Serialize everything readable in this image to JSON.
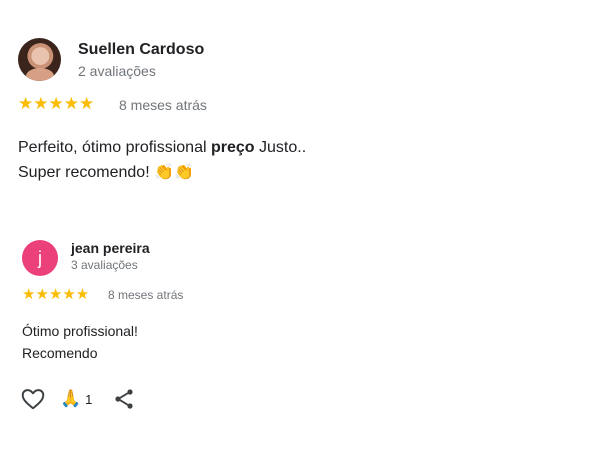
{
  "reviews": [
    {
      "author": "Suellen Cardoso",
      "review_count": "2 avaliações",
      "stars": "★★★★★",
      "rating": 5,
      "date": "8 meses atrás",
      "text_line1_a": "Perfeito, ótimo profissional ",
      "text_line1_bold": "preço",
      "text_line1_b": " Justo..",
      "text_line2": "Super recomendo! 👏👏"
    },
    {
      "author": "jean pereira",
      "avatar_letter": "j",
      "review_count": "3 avaliações",
      "stars": "★★★★★",
      "rating": 5,
      "date": "8 meses atrás",
      "text_line1": "Ótimo profissional!",
      "text_line2": "Recomendo"
    }
  ],
  "actions": {
    "like_icon": "heart-outline-icon",
    "reaction_emoji": "🙏",
    "reaction_count": "1",
    "share_icon": "share-icon"
  },
  "colors": {
    "star": "#fbbc04",
    "avatar_j": "#ec407a",
    "secondary_text": "#70757a"
  }
}
